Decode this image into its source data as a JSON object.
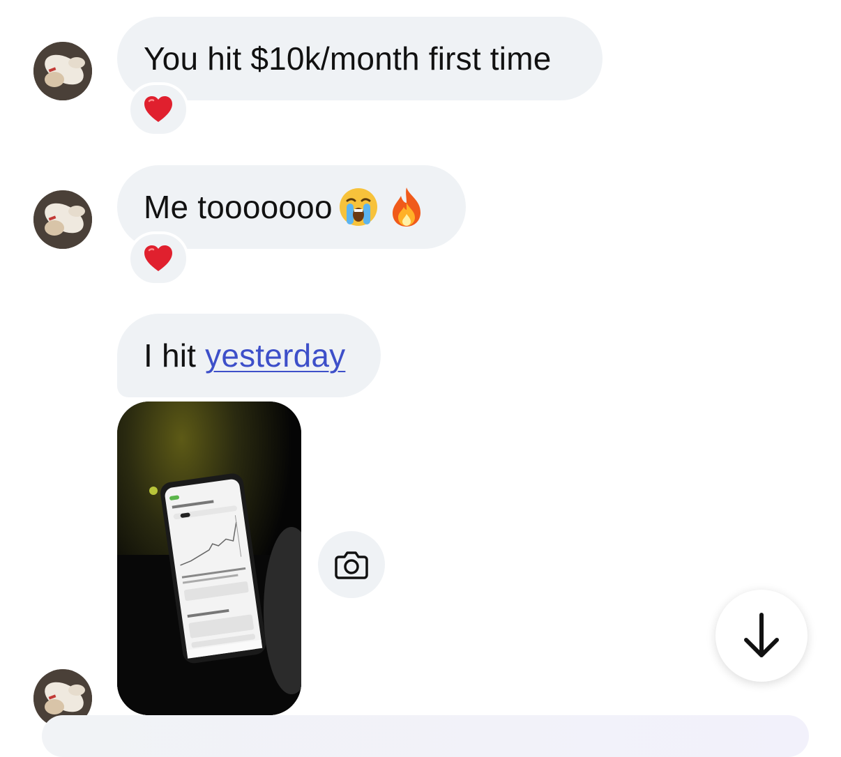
{
  "messages": [
    {
      "text": "You hit $10k/month first time",
      "reaction": "heart-emoji"
    },
    {
      "text": "Me tooooooo",
      "emojis": [
        "crying-face-emoji",
        "fire-emoji"
      ],
      "reaction": "heart-emoji"
    },
    {
      "text_prefix": "I hit ",
      "link_text": "yesterday"
    }
  ],
  "photo": {
    "subject": "phone-screenshot-photo"
  },
  "controls": {
    "camera_icon": "camera-icon",
    "scroll_icon": "arrow-down-icon"
  },
  "colors": {
    "bubble": "#eff2f5",
    "link": "#3d4fc9",
    "heart": "#e0202e"
  }
}
